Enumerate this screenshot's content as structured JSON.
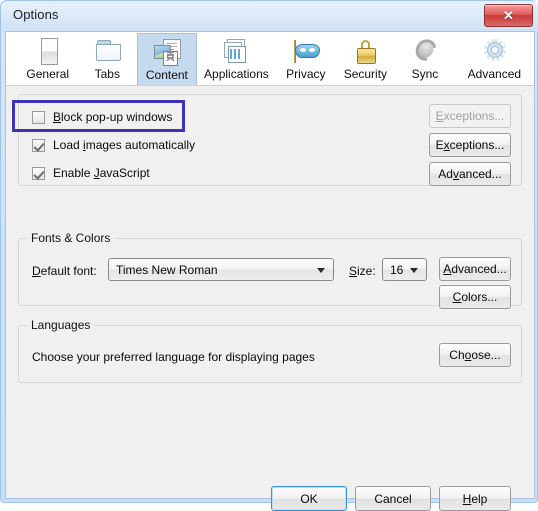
{
  "window": {
    "title": "Options",
    "close_label": "✕",
    "close_name": "close-icon"
  },
  "tabs": [
    {
      "label": "General",
      "icon": "monitor-icon",
      "selected": false
    },
    {
      "label": "Tabs",
      "icon": "folder-icon",
      "selected": false
    },
    {
      "label": "Content",
      "icon": "content-page-icon",
      "selected": true
    },
    {
      "label": "Applications",
      "icon": "windows-grid-icon",
      "selected": false
    },
    {
      "label": "Privacy",
      "icon": "mask-icon",
      "selected": false
    },
    {
      "label": "Security",
      "icon": "padlock-icon",
      "selected": false
    },
    {
      "label": "Sync",
      "icon": "sync-refresh-icon",
      "selected": false
    },
    {
      "label": "Advanced",
      "icon": "gear-icon",
      "selected": false
    }
  ],
  "content_panel": {
    "checkboxes": [
      {
        "label_pre": "",
        "accel": "B",
        "label_post": "lock pop-up windows",
        "checked": false,
        "highlighted": true
      },
      {
        "label_pre": "Load ",
        "accel": "i",
        "label_post": "mages automatically",
        "checked": true,
        "highlighted": false
      },
      {
        "label_pre": "Enable ",
        "accel": "J",
        "label_post": "avaScript",
        "checked": true,
        "highlighted": false
      }
    ],
    "side_buttons": [
      {
        "label_pre": "",
        "accel": "E",
        "label_post": "xceptions...",
        "disabled": true
      },
      {
        "label_pre": "E",
        "accel": "x",
        "label_post": "ceptions...",
        "disabled": false
      },
      {
        "label_pre": "Ad",
        "accel": "v",
        "label_post": "anced...",
        "disabled": false
      }
    ]
  },
  "fonts_colors": {
    "legend": "Fonts & Colors",
    "default_font_label_pre": "",
    "default_font_label_accel": "D",
    "default_font_label_post": "efault font:",
    "default_font_value": "Times New Roman",
    "size_label_pre": "",
    "size_label_accel": "S",
    "size_label_post": "ize:",
    "size_value": "16",
    "advanced_pre": "",
    "advanced_accel": "A",
    "advanced_post": "dvanced...",
    "colors_pre": "",
    "colors_accel": "C",
    "colors_post": "olors..."
  },
  "languages": {
    "legend": "Languages",
    "description": "Choose your preferred language for displaying pages",
    "choose_pre": "Ch",
    "choose_accel": "o",
    "choose_post": "ose..."
  },
  "footer_buttons": {
    "ok": "OK",
    "cancel": "Cancel",
    "help_pre": "",
    "help_accel": "H",
    "help_post": "elp"
  },
  "colors": {
    "highlight_border": "#3b33b5",
    "tab_selected_bg": "#c6daef",
    "window_frame": "#cfe2f6",
    "panel_bg": "#f0f0f0",
    "close_button": "#d94a4a",
    "default_button_focus": "#3b93d6"
  }
}
